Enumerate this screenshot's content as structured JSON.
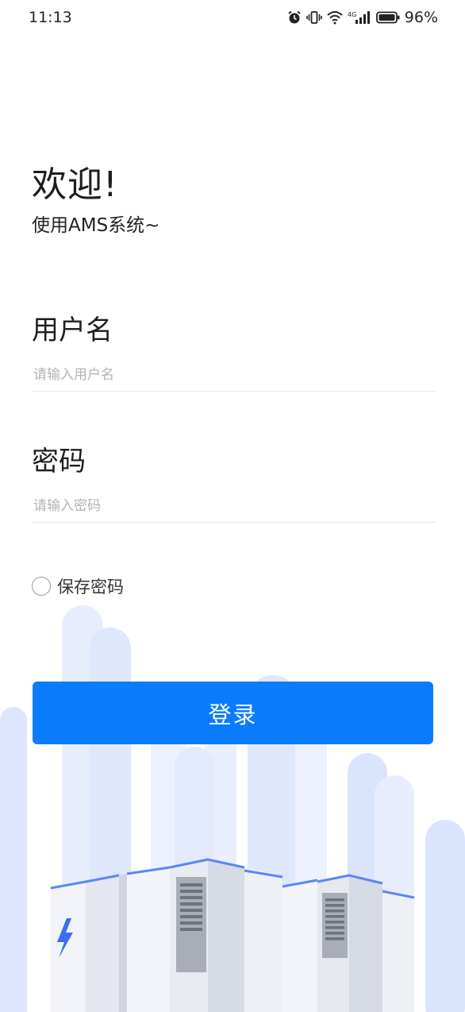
{
  "status_bar": {
    "time": "11:13",
    "network": "4G",
    "battery": "96%",
    "icons": [
      "alarm-icon",
      "vibrate-icon",
      "wifi-icon",
      "signal-icon",
      "battery-icon"
    ]
  },
  "welcome": {
    "title": "欢迎!",
    "subtitle": "使用AMS系统~"
  },
  "username": {
    "label": "用户名",
    "value": "",
    "placeholder": "请输入用户名"
  },
  "password": {
    "label": "密码",
    "value": "",
    "placeholder": "请输入密码"
  },
  "remember": {
    "label": "保存密码",
    "checked": false
  },
  "login": {
    "label": "登录"
  },
  "colors": {
    "accent": "#0a7cfb",
    "background_pillars": "#dde6fd",
    "server_body": "#eef0f6",
    "server_edge": "#5b86f5"
  },
  "illustration": {
    "icon": "lightning-bolt-icon"
  }
}
